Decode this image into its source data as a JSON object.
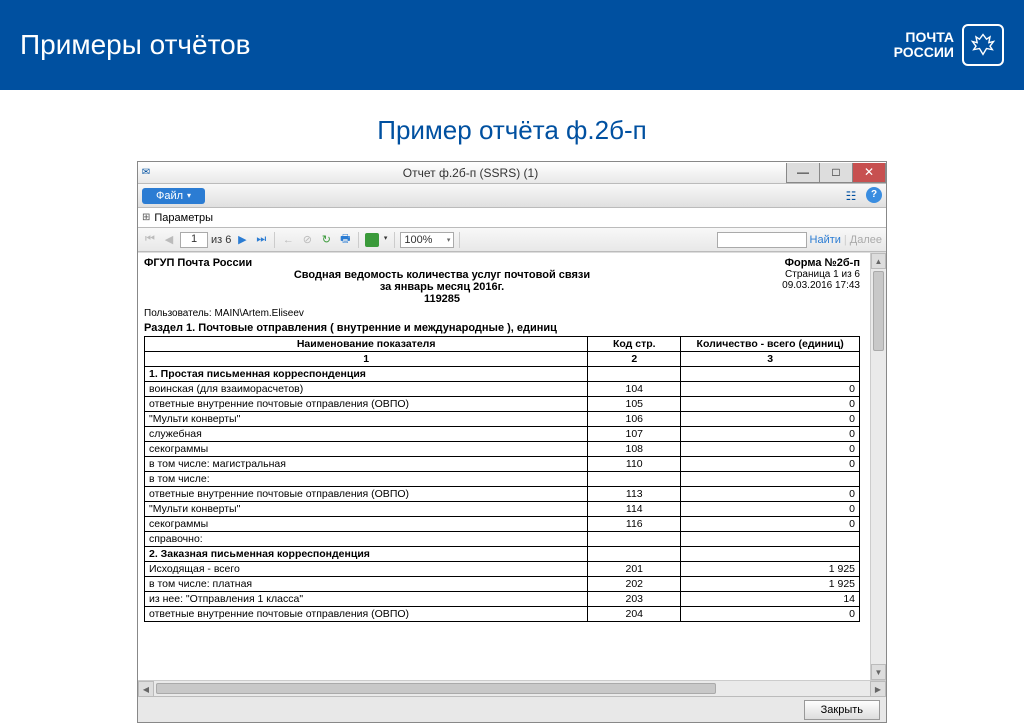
{
  "banner": {
    "title": "Примеры отчётов",
    "logo_line1": "ПОЧТА",
    "logo_line2": "РОССИИ"
  },
  "subtitle": "Пример отчёта ф.2б-п",
  "window": {
    "title": "Отчет ф.2б-п (SSRS) (1)"
  },
  "menu": {
    "file": "Файл"
  },
  "params": {
    "label": "Параметры"
  },
  "toolbar": {
    "page": "1",
    "of_label": "из",
    "total_pages": "6",
    "zoom": "100%",
    "find": "Найти",
    "next": "Далее"
  },
  "report": {
    "org": "ФГУП Почта России",
    "form": "Форма №2б-п",
    "title1": "Сводная ведомость количества услуг почтовой связи",
    "title2": "за январь месяц  2016г.",
    "code": "119285",
    "page_info": "Страница 1 из 6",
    "timestamp": "09.03.2016 17:43",
    "user_label": "Пользователь: MAIN\\Artem.Eliseev",
    "section": "Раздел 1. Почтовые отправления  ( внутренние  и  международные ),  единиц",
    "headers": {
      "name": "Наименование показателя",
      "code": "Код стр.",
      "qty": "Количество - всего (единиц)"
    },
    "hnum": {
      "c1": "1",
      "c2": "2",
      "c3": "3"
    },
    "rows": [
      {
        "name": "1. Простая письменная корреспонденция",
        "code": "",
        "qty": "",
        "bold": true
      },
      {
        "name": "воинская (для взаиморасчетов)",
        "code": "104",
        "qty": "0",
        "indent": 2
      },
      {
        "name": "ответные внутренние почтовые отправления (ОВПО)",
        "code": "105",
        "qty": "0",
        "indent": 2
      },
      {
        "name": "\"Мульти конверты\"",
        "code": "106",
        "qty": "0",
        "indent": 2
      },
      {
        "name": "служебная",
        "code": "107",
        "qty": "0",
        "indent": 1
      },
      {
        "name": "секограммы",
        "code": "108",
        "qty": "0",
        "indent": 1
      },
      {
        "name": "в том числе: магистральная",
        "code": "110",
        "qty": "0",
        "indent": 1
      },
      {
        "name": "в том числе:",
        "code": "",
        "qty": "",
        "indent": 1
      },
      {
        "name": "ответные внутренние почтовые отправления (ОВПО)",
        "code": "113",
        "qty": "0",
        "indent": 2
      },
      {
        "name": "\"Мульти конверты\"",
        "code": "114",
        "qty": "0",
        "indent": 2
      },
      {
        "name": "секограммы",
        "code": "116",
        "qty": "0",
        "indent": 2
      },
      {
        "name": "справочно:",
        "code": "",
        "qty": "",
        "indent": 1
      },
      {
        "name": "2. Заказная письменная корреспонденция",
        "code": "",
        "qty": "",
        "bold": true
      },
      {
        "name": "Исходящая - всего",
        "code": "201",
        "qty": "1 925",
        "indent": 1
      },
      {
        "name": "в том числе: платная",
        "code": "202",
        "qty": "1 925",
        "indent": 2
      },
      {
        "name": "из нее: \"Отправления 1 класса\"",
        "code": "203",
        "qty": "14",
        "indent": 3
      },
      {
        "name": "ответные внутренние почтовые отправления (ОВПО)",
        "code": "204",
        "qty": "0",
        "indent": 3
      }
    ]
  },
  "footer": {
    "close": "Закрыть"
  }
}
